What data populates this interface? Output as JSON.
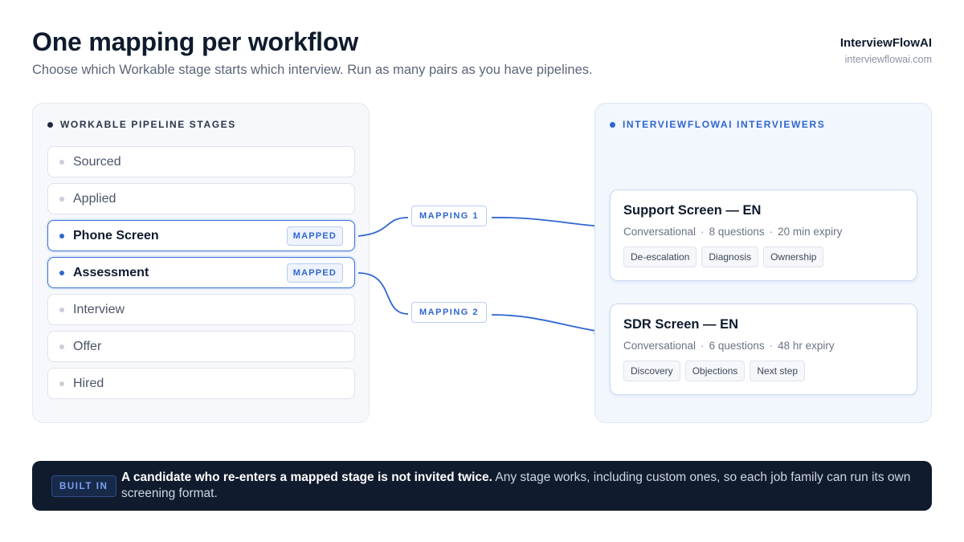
{
  "header": {
    "title": "One mapping per workflow",
    "subtitle": "Choose which Workable stage starts which interview. Run as many pairs as you have pipelines.",
    "brand_name": "InterviewFlowAI",
    "brand_url": "interviewflowai.com"
  },
  "left_panel": {
    "heading": "WORKABLE PIPELINE STAGES",
    "stages": [
      {
        "label": "Sourced",
        "mapped": false
      },
      {
        "label": "Applied",
        "mapped": false
      },
      {
        "label": "Phone Screen",
        "mapped": true,
        "badge": "MAPPED"
      },
      {
        "label": "Assessment",
        "mapped": true,
        "badge": "MAPPED"
      },
      {
        "label": "Interview",
        "mapped": false
      },
      {
        "label": "Offer",
        "mapped": false
      },
      {
        "label": "Hired",
        "mapped": false
      }
    ]
  },
  "mappings": [
    {
      "label": "MAPPING 1",
      "from": "Phone Screen",
      "to": "Support Screen — EN"
    },
    {
      "label": "MAPPING 2",
      "from": "Assessment",
      "to": "SDR Screen — EN"
    }
  ],
  "right_panel": {
    "heading": "INTERVIEWFLOWAI INTERVIEWERS",
    "cards": [
      {
        "title": "Support Screen — EN",
        "type": "Conversational",
        "questions": "8 questions",
        "expiry": "20 min expiry",
        "tags": [
          "De-escalation",
          "Diagnosis",
          "Ownership"
        ]
      },
      {
        "title": "SDR Screen — EN",
        "type": "Conversational",
        "questions": "6 questions",
        "expiry": "48 hr expiry",
        "tags": [
          "Discovery",
          "Objections",
          "Next step"
        ]
      }
    ]
  },
  "banner": {
    "badge": "BUILT IN",
    "bold_text": "A candidate who re-enters a mapped stage is not invited twice.",
    "text": " Any stage works, including custom ones, so each job family can run its own screening format."
  },
  "colors": {
    "accent": "#2f66d0",
    "banner_bg": "#101b2d"
  }
}
